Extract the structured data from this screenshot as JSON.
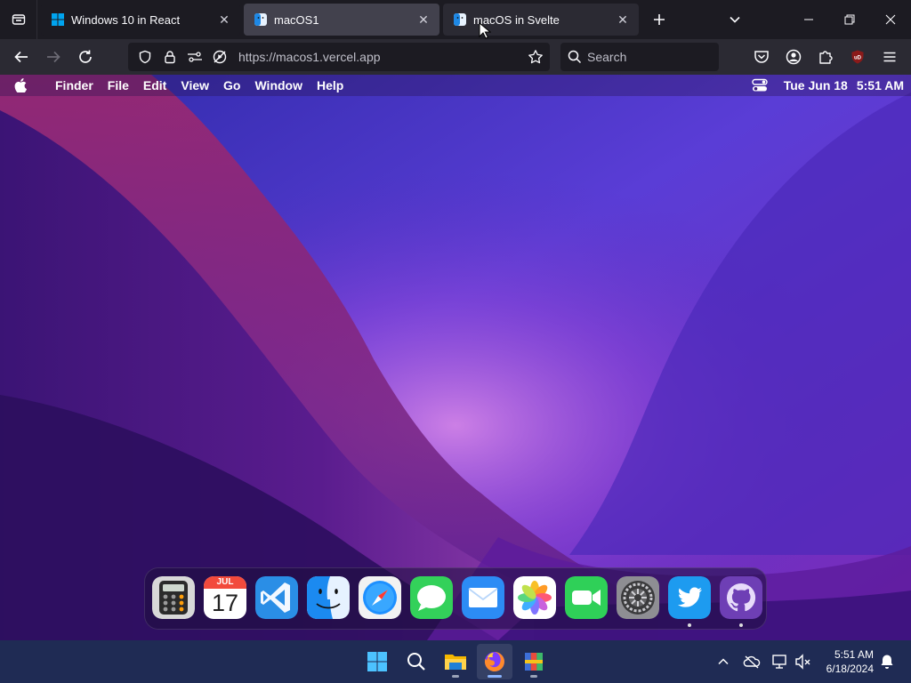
{
  "browser": {
    "tabs": [
      {
        "title": "Windows 10 in React",
        "active": false
      },
      {
        "title": "macOS1",
        "active": true
      },
      {
        "title": "macOS in Svelte",
        "active": false
      }
    ],
    "address": "https://macos1.vercel.app",
    "search_placeholder": "Search",
    "colors": {
      "tabstrip": "#1c1b22",
      "toolbar": "#2b2a33",
      "active_tab": "#42414d",
      "ublock": "#8b1a1a"
    }
  },
  "macos": {
    "menubar": {
      "apple_icon": "apple-logo-icon",
      "items": [
        "Finder",
        "File",
        "Edit",
        "View",
        "Go",
        "Window",
        "Help"
      ],
      "date": "Tue Jun 18",
      "time": "5:51 AM",
      "control_center_icon": "control-center-icon"
    },
    "dock": {
      "calendar_month": "JUL",
      "calendar_day": "17",
      "apps": [
        "calculator",
        "calendar",
        "vscode",
        "finder",
        "safari",
        "messages",
        "mail",
        "photos",
        "facetime",
        "system-preferences",
        "twitter",
        "github"
      ],
      "running": [
        "twitter",
        "github"
      ]
    }
  },
  "taskbar": {
    "apps": [
      "start",
      "search",
      "file-explorer",
      "firefox",
      "winrar"
    ],
    "active_app": "firefox",
    "time": "5:51 AM",
    "date": "6/18/2024",
    "accent": "#1f2b54"
  }
}
